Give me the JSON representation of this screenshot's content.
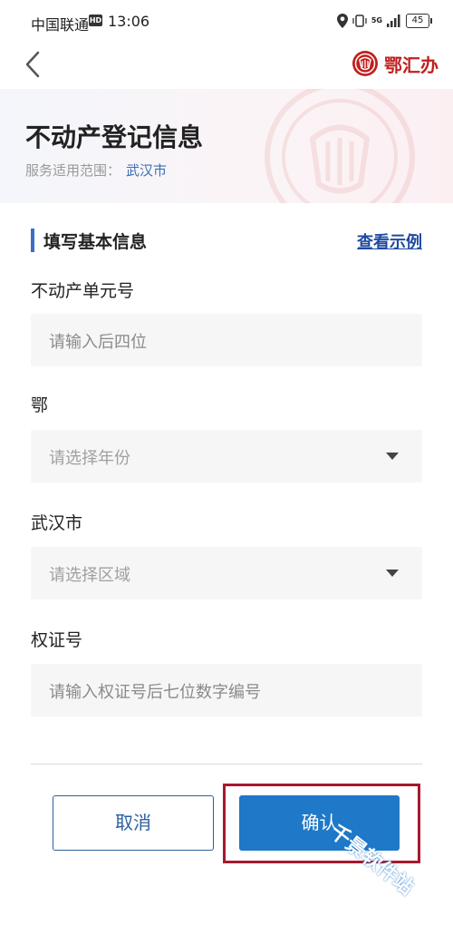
{
  "status_bar": {
    "carrier": "中国联通",
    "hd": "HD",
    "time": "13:06",
    "signal": "5G",
    "battery": "45"
  },
  "nav": {
    "logo_text": "鄂汇办"
  },
  "hero": {
    "title": "不动产登记信息",
    "scope_label": "服务适用范围：",
    "scope_value": "武汉市"
  },
  "section": {
    "title": "填写基本信息",
    "example_link": "查看示例"
  },
  "fields": [
    {
      "label": "不动产单元号",
      "placeholder": "请输入后四位"
    },
    {
      "label": "鄂",
      "placeholder": "请选择年份"
    },
    {
      "label": "武汉市",
      "placeholder": "请选择区域"
    },
    {
      "label": "权证号",
      "placeholder": "请输入权证号后七位数字编号"
    }
  ],
  "buttons": {
    "cancel": "取消",
    "confirm": "确认"
  },
  "watermark": "千景软件站",
  "colors": {
    "accent": "#1f78c8",
    "link": "#1f4aa0",
    "brand_red": "#c0201e",
    "highlight": "#a6192e"
  }
}
